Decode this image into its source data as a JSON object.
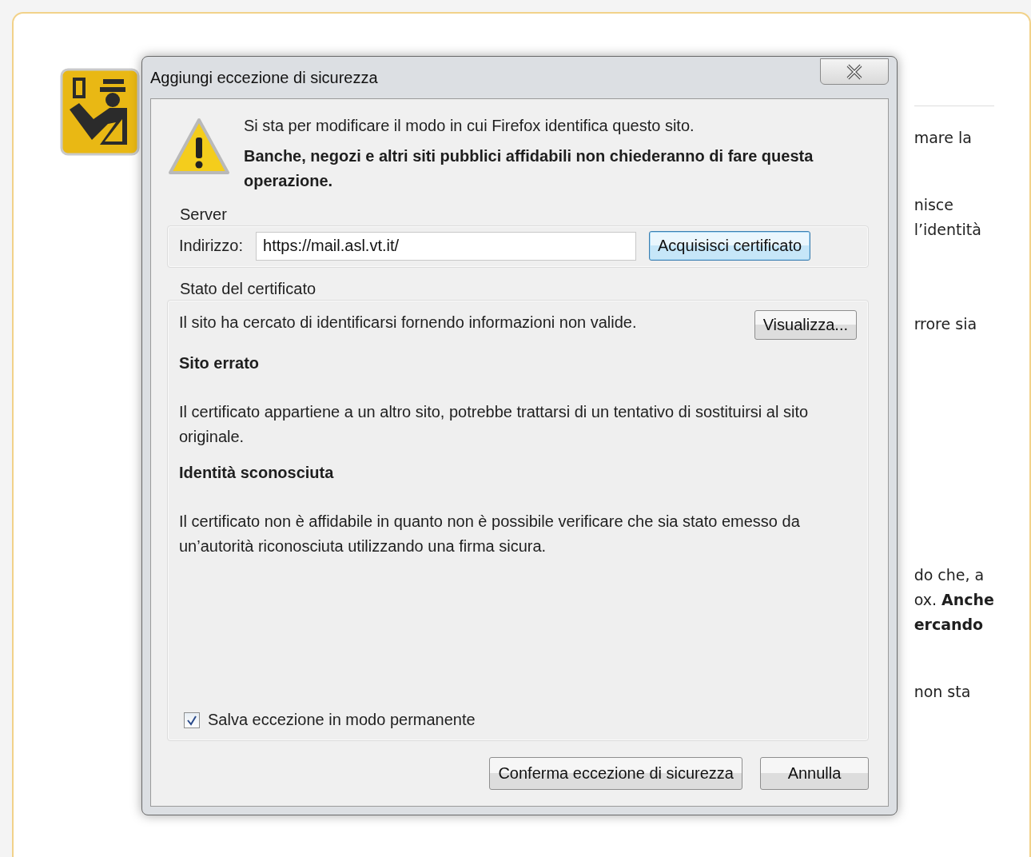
{
  "background_page": {
    "text_fragments": [
      [
        "mare la"
      ],
      [
        "nisce",
        "l’identità"
      ],
      [
        "rrore sia"
      ],
      [
        "do che, a",
        "ox. **Anche**",
        "**ercando**"
      ],
      [
        "non sta"
      ]
    ]
  },
  "dialog": {
    "title": "Aggiungi eccezione di sicurezza",
    "warning": "Si sta per modificare il modo in cui Firefox identifica questo sito.",
    "warning_bold": "Banche, negozi e altri siti pubblici affidabili non chiederanno di fare questa operazione.",
    "server": {
      "legend": "Server",
      "address_label": "Indirizzo:",
      "address_value": "https://mail.asl.vt.it/",
      "fetch_button": "Acquisisci certificato"
    },
    "certificate_status": {
      "legend": "Stato del certificato",
      "summary": "Il sito ha cercato di identificarsi fornendo informazioni non valide.",
      "view_button": "Visualizza...",
      "problems": [
        {
          "heading": "Sito errato",
          "text": "Il certificato appartiene a un altro sito, potrebbe trattarsi di un tentativo di sostituirsi al sito originale."
        },
        {
          "heading": "Identità sconosciuta",
          "text": "Il certificato non è affidabile in quanto non è possibile verificare che sia stato emesso da un’autorità riconosciuta utilizzando una firma sicura."
        }
      ]
    },
    "save_permanently": {
      "label": "Salva eccezione in modo permanente",
      "checked": true
    },
    "buttons": [
      {
        "label": "Conferma eccezione di sicurezza"
      },
      {
        "label": "Annulla"
      }
    ]
  }
}
